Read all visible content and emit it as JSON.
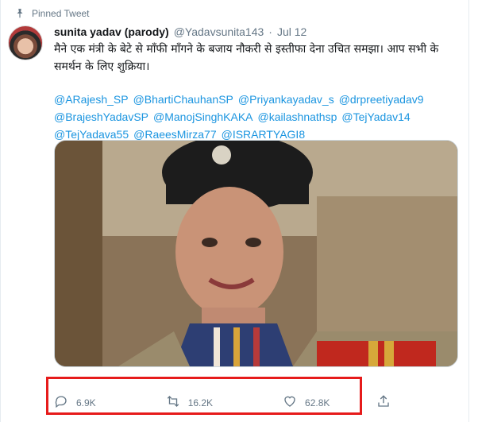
{
  "pinned": {
    "label": "Pinned Tweet",
    "icon": "pin-icon"
  },
  "author": {
    "name": "sunita yadav (parody)",
    "handle": "@Yadavsunita143",
    "separator": "·",
    "date": "Jul 12"
  },
  "tweet": {
    "text": "मैने एक मंत्री के बेटे से माँफी माँगने के बजाय नौकरी से इस्तीफा देना उचित समझा।  आप सभी के समर्थन के लिए शुक्रिया।",
    "mentions": [
      "@ARajesh_SP",
      "@BhartiChauhanSP",
      "@Priyankayadav_s",
      "@drpreetiyadav9",
      "@BrajeshYadavSP",
      "@ManojSinghKAKA",
      "@kailashnathsp",
      "@TejYadav14",
      "@TejYadava55",
      "@RaeesMirza77",
      "@ISRARTYAGI8"
    ]
  },
  "actions": {
    "reply": {
      "icon": "reply-icon",
      "count": "6.9K"
    },
    "retweet": {
      "icon": "retweet-icon",
      "count": "16.2K"
    },
    "like": {
      "icon": "heart-icon",
      "count": "62.8K"
    },
    "share": {
      "icon": "share-icon"
    }
  },
  "colors": {
    "link": "#1b95e0",
    "muted": "#657786",
    "highlight": "#e61b1b"
  }
}
